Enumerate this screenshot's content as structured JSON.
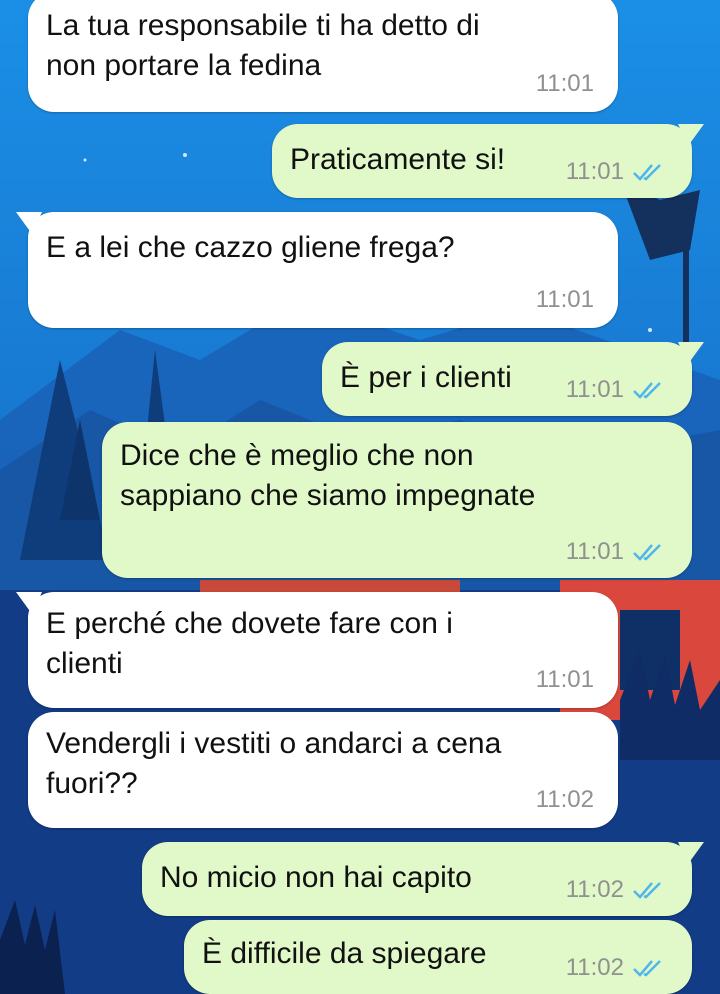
{
  "messages": [
    {
      "dir": "in",
      "text": "La tua responsabile ti ha detto di\nnon portare la fedina",
      "time": "11:01"
    },
    {
      "dir": "out",
      "text": "Praticamente si!",
      "time": "11:01",
      "status": "read-double-check-icon"
    },
    {
      "dir": "in",
      "text": "E a lei che cazzo gliene frega?",
      "time": "11:01"
    },
    {
      "dir": "out",
      "text": "È per i clienti",
      "time": "11:01",
      "status": "read-double-check-icon"
    },
    {
      "dir": "out",
      "text": "Dice che è meglio che non\nsappiano che siamo impegnate",
      "time": "11:01",
      "status": "read-double-check-icon"
    },
    {
      "dir": "in",
      "text": "E perché che dovete fare con i\nclienti",
      "time": "11:01"
    },
    {
      "dir": "in",
      "text": "Vendergli i vestiti o andarci a cena\nfuori??",
      "time": "11:02"
    },
    {
      "dir": "out",
      "text": "No micio non hai capito",
      "time": "11:02",
      "status": "read-double-check-icon"
    },
    {
      "dir": "out",
      "text": "È difficile da spiegare",
      "time": "11:02",
      "status": "read-double-check-icon"
    }
  ],
  "colors": {
    "incoming_bubble": "#ffffff",
    "outgoing_bubble": "#e1f9c9",
    "read_ticks": "#4fb6ec",
    "time_text": "#909090",
    "wallpaper_sky": "#1c7fd6"
  }
}
